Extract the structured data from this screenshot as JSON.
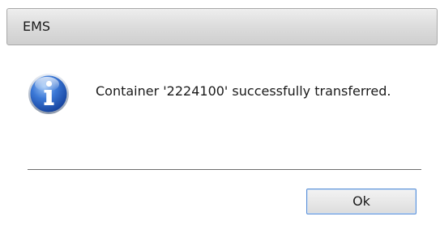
{
  "dialog": {
    "title": "EMS",
    "message": "Container '2224100' successfully transferred.",
    "icon": "information-icon",
    "ok_label": "Ok"
  }
}
